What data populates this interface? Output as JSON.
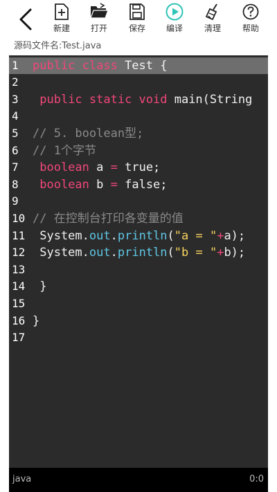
{
  "toolbar": {
    "items": [
      {
        "label": "新建",
        "icon": "new-file-icon"
      },
      {
        "label": "打开",
        "icon": "open-folder-icon"
      },
      {
        "label": "保存",
        "icon": "save-icon"
      },
      {
        "label": "编译",
        "icon": "play-icon"
      },
      {
        "label": "清理",
        "icon": "broom-icon"
      },
      {
        "label": "帮助",
        "icon": "help-icon"
      }
    ],
    "back_icon": "back-arrow-icon"
  },
  "file": {
    "label": "源码文件名:",
    "name": "Test.java"
  },
  "colors": {
    "accent_compile": "#2ec4b6",
    "editor_bg": "#2b2b2b",
    "keyword": "#f0477a",
    "comment": "#8a8a8a",
    "method": "#5fc7e6",
    "string": "#f7d35f"
  },
  "editor": {
    "lines": [
      {
        "n": "1",
        "tokens": [
          [
            "kw",
            "public class"
          ],
          [
            "tx",
            " Test {"
          ]
        ]
      },
      {
        "n": "2",
        "tokens": []
      },
      {
        "n": "3",
        "tokens": [
          [
            "tx",
            " "
          ],
          [
            "kw",
            "public static void"
          ],
          [
            "tx",
            " main(String"
          ]
        ]
      },
      {
        "n": "4",
        "tokens": []
      },
      {
        "n": "5",
        "tokens": [
          [
            "cm",
            "// 5. boolean型;"
          ]
        ]
      },
      {
        "n": "6",
        "tokens": [
          [
            "cm",
            "// 1个字节"
          ]
        ]
      },
      {
        "n": "7",
        "tokens": [
          [
            "tx",
            " "
          ],
          [
            "kw",
            "boolean"
          ],
          [
            "tx",
            " a "
          ],
          [
            "op",
            "="
          ],
          [
            "tx",
            " true;"
          ]
        ]
      },
      {
        "n": "8",
        "tokens": [
          [
            "tx",
            " "
          ],
          [
            "kw",
            "boolean"
          ],
          [
            "tx",
            " b "
          ],
          [
            "op",
            "="
          ],
          [
            "tx",
            " false;"
          ]
        ]
      },
      {
        "n": "9",
        "tokens": []
      },
      {
        "n": "10",
        "tokens": [
          [
            "cm",
            "// 在控制台打印各变量的值"
          ]
        ]
      },
      {
        "n": "11",
        "tokens": [
          [
            "tx",
            " System."
          ],
          [
            "fn",
            "out"
          ],
          [
            "tx",
            "."
          ],
          [
            "fn",
            "println"
          ],
          [
            "tx",
            "("
          ],
          [
            "st",
            "\"a = \""
          ],
          [
            "op",
            "+"
          ],
          [
            "tx",
            "a);"
          ]
        ]
      },
      {
        "n": "12",
        "tokens": [
          [
            "tx",
            " System."
          ],
          [
            "fn",
            "out"
          ],
          [
            "tx",
            "."
          ],
          [
            "fn",
            "println"
          ],
          [
            "tx",
            "("
          ],
          [
            "st",
            "\"b = \""
          ],
          [
            "op",
            "+"
          ],
          [
            "tx",
            "b);"
          ]
        ]
      },
      {
        "n": "13",
        "tokens": []
      },
      {
        "n": "14",
        "tokens": [
          [
            "tx",
            " }"
          ]
        ]
      },
      {
        "n": "15",
        "tokens": []
      },
      {
        "n": "16",
        "tokens": [
          [
            "tx",
            "}"
          ]
        ]
      },
      {
        "n": "17",
        "tokens": []
      }
    ]
  },
  "status": {
    "language": "java",
    "cursor": "0:0"
  }
}
